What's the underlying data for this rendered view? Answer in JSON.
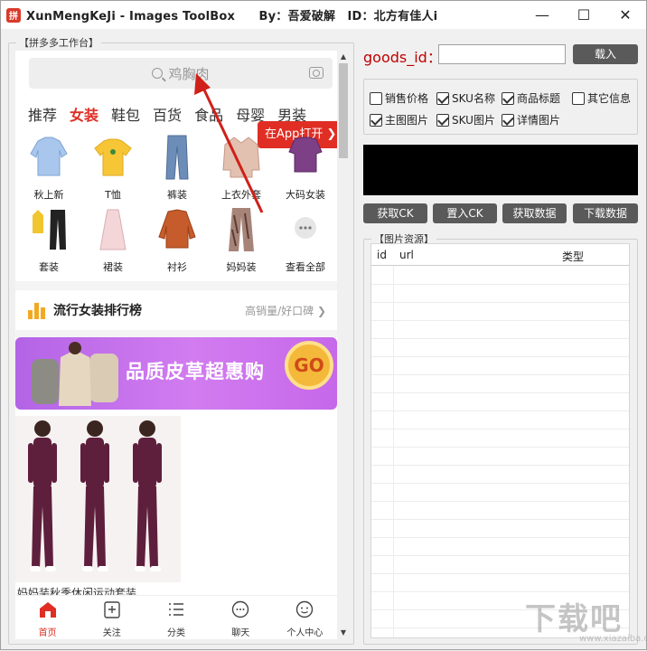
{
  "window": {
    "title": "XunMengKeJi - Images ToolBox　　By：吾爱破解　ID：北方有佳人i",
    "minimize_glyph": "—",
    "maximize_glyph": "☐",
    "close_glyph": "✕"
  },
  "left_panel": {
    "legend": "【拼多多工作台】",
    "search_placeholder": "鸡胸肉",
    "tabs": [
      "推荐",
      "女装",
      "鞋包",
      "百货",
      "食品",
      "母婴",
      "男装"
    ],
    "active_tab": "女装",
    "open_app": "在App打开",
    "categories": [
      "秋上新",
      "T恤",
      "裤装",
      "上衣外套",
      "大码女装",
      "套装",
      "裙装",
      "衬衫",
      "妈妈装",
      "查看全部"
    ],
    "ranking_title": "流行女装排行榜",
    "ranking_sub": "高销量/好口碑",
    "banner_text": "品质皮草超惠购",
    "banner_go": "GO",
    "product_title": "妈妈装秋季休闲运动套装",
    "nav": [
      "首页",
      "关注",
      "分类",
      "聊天",
      "个人中心"
    ]
  },
  "right_panel": {
    "goods_id_label": "goods_id：",
    "goods_id_value": "",
    "load_button": "载入",
    "options": [
      {
        "label": "销售价格",
        "checked": false
      },
      {
        "label": "SKU名称",
        "checked": true
      },
      {
        "label": "商品标题",
        "checked": true
      },
      {
        "label": "其它信息",
        "checked": false
      },
      {
        "label": "主图图片",
        "checked": true
      },
      {
        "label": "SKU图片",
        "checked": true
      },
      {
        "label": "详情图片",
        "checked": true
      }
    ],
    "buttons": [
      "获取CK",
      "置入CK",
      "获取数据",
      "下载数据"
    ],
    "images_legend": "【图片资源】",
    "columns": [
      "id",
      "url",
      "类型"
    ]
  },
  "watermark": {
    "main": "下载吧",
    "sub": "www.xiazaiba.com"
  },
  "colors": {
    "accent_red": "#e02e24",
    "button_gray": "#5a5a5a",
    "label_red": "#c00000"
  }
}
